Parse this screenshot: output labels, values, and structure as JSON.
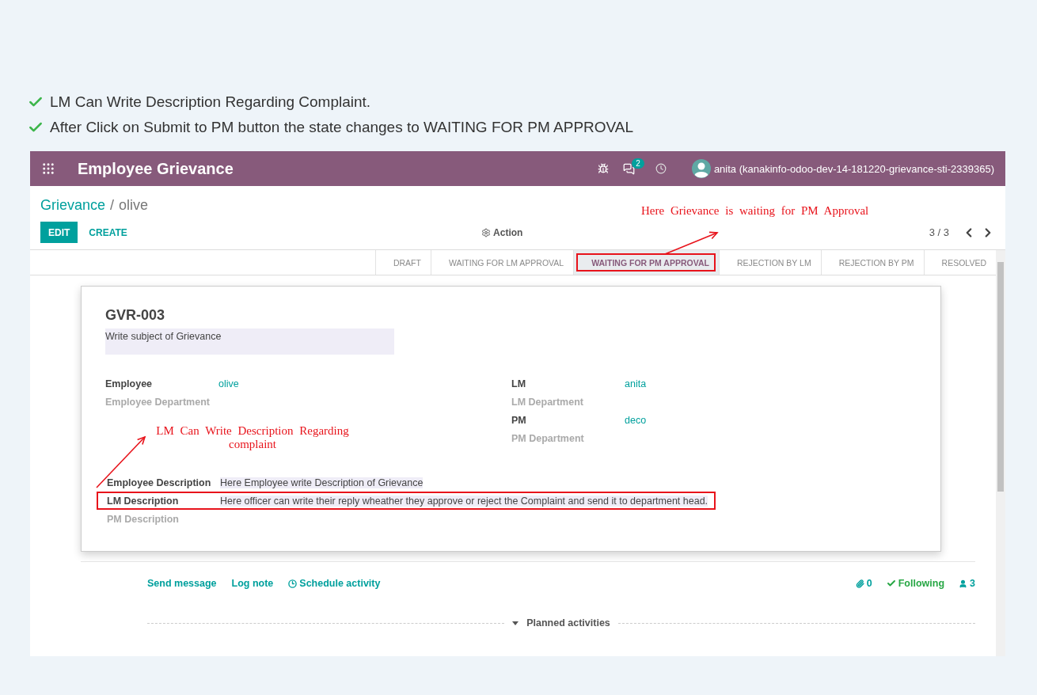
{
  "notes": [
    {
      "text": "LM Can Write Description Regarding Complaint."
    },
    {
      "text": "After Click on Submit to PM button the state changes to WAITING FOR PM APPROVAL"
    }
  ],
  "navbar": {
    "title": "Employee Grievance",
    "messages_badge": "2",
    "user": "anita (kanakinfo-odoo-dev-14-181220-grievance-sti-2339365)"
  },
  "breadcrumb": {
    "parent": "Grievance",
    "separator": "/",
    "current": "olive"
  },
  "buttons": [
    {
      "label": "EDIT",
      "kind": "primary"
    },
    {
      "label": "CREATE",
      "kind": "link"
    }
  ],
  "action": "Action",
  "pager": "3 / 3",
  "stages": [
    {
      "label": "DRAFT",
      "selected": false
    },
    {
      "label": "WAITING FOR LM APPROVAL",
      "selected": false
    },
    {
      "label": "WAITING FOR PM APPROVAL",
      "selected": true
    },
    {
      "label": "REJECTION BY LM",
      "selected": false
    },
    {
      "label": "REJECTION BY PM",
      "selected": false
    },
    {
      "label": "RESOLVED",
      "selected": false
    }
  ],
  "form": {
    "reference": "GVR-003",
    "subject": "Write subject of Grievance",
    "left_fields": [
      {
        "label": "Employee",
        "value": "olive"
      },
      {
        "label": "Employee Department"
      }
    ],
    "right_fields": [
      {
        "label": "LM",
        "value": "anita"
      },
      {
        "label": "LM Department"
      },
      {
        "label": "PM",
        "value": "deco"
      },
      {
        "label": "PM Department"
      }
    ],
    "descriptions": [
      {
        "label": "Employee Description",
        "value": "Here Employee write Description of Grievance",
        "annotated": false
      },
      {
        "label": "LM Description",
        "value": "Here officer can write their reply wheather they approve or reject the Complaint and send it to department head.",
        "annotated": true
      },
      {
        "label": "PM Description",
        "annotated": false
      }
    ]
  },
  "chatter": {
    "actions": [
      "Send message",
      "Log note",
      "Schedule activity"
    ],
    "attachments": "0",
    "follow": "Following",
    "followers": "3",
    "planned": "Planned activities"
  },
  "annotations": [
    {
      "text": "Here Grievance is waiting for PM Approval"
    },
    {
      "text": "LM Can Write Description Regarding complaint"
    }
  ]
}
